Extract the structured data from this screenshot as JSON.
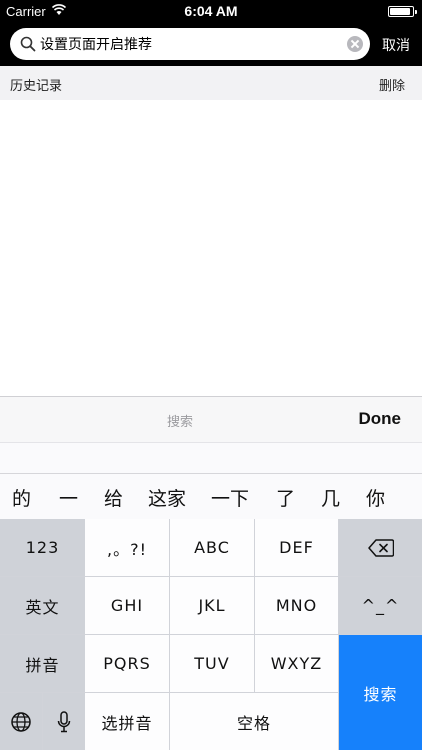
{
  "status_bar": {
    "carrier": "Carrier",
    "time": "6:04 AM",
    "battery_level": 0.9
  },
  "search": {
    "value": "设置页面开启推荐",
    "cancel_label": "取消"
  },
  "history": {
    "title": "历史记录",
    "delete_label": "删除"
  },
  "accessory_bar": {
    "search_label": "搜索",
    "done_label": "Done"
  },
  "candidates": [
    "的",
    "一",
    "给",
    "这家",
    "一下",
    "了",
    "几",
    "你"
  ],
  "keyboard": {
    "key_123": "123",
    "key_punct": ",。?!",
    "key_abc": "ABC",
    "key_def": "DEF",
    "key_english": "英文",
    "key_ghi": "GHI",
    "key_jkl": "JKL",
    "key_mno": "MNO",
    "key_emoticon": "^_^",
    "key_pinyin": "拼音",
    "key_pqrs": "PQRS",
    "key_tuv": "TUV",
    "key_wxyz": "WXYZ",
    "key_select_pinyin": "选拼音",
    "key_space": "空格",
    "key_search": "搜索"
  },
  "colors": {
    "header_bg": "#000000",
    "accent_blue": "#1681fb",
    "keyboard_bg": "#d1d3d9"
  }
}
